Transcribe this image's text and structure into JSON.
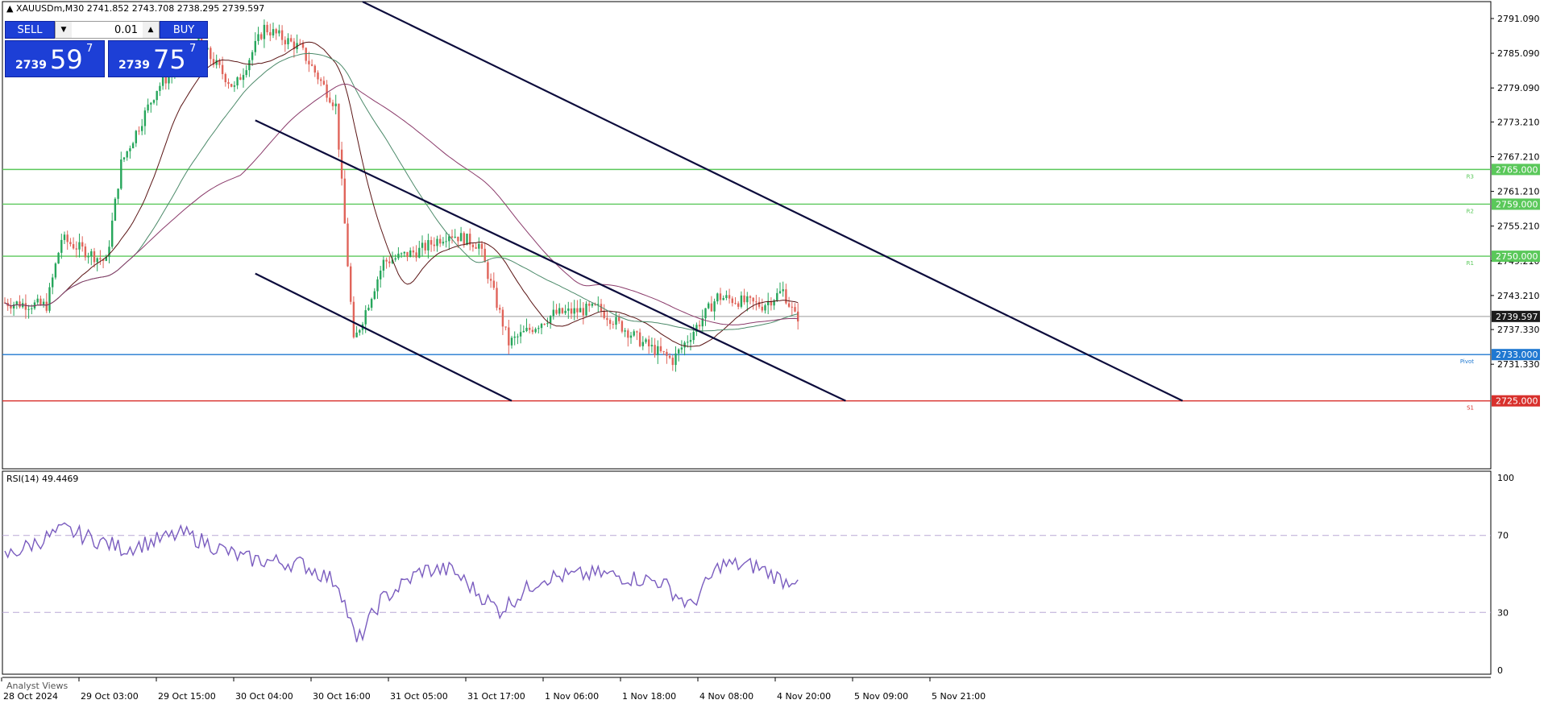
{
  "header": {
    "symbol": "XAUUSDm,M30",
    "ohlc": "2741.852 2743.708 2738.295 2739.597"
  },
  "trade_panel": {
    "sell_label": "SELL",
    "buy_label": "BUY",
    "lot": "0.01",
    "sell_price_small": "2739",
    "sell_price_big": "59",
    "sell_price_sup": "7",
    "buy_price_small": "2739",
    "buy_price_big": "75",
    "buy_price_sup": "7"
  },
  "analyst_views": "Analyst Views",
  "colors": {
    "bull": "#26a65b",
    "bear": "#e0645a",
    "level_green": "#5ac85a",
    "pivot": "#1f78d1",
    "s_level": "#d8302c",
    "trendline": "#0c0c3c",
    "rsi": "#7a5cbf",
    "ma_fast": "#5a1414",
    "ma_mid": "#4c8a6a",
    "ma_slow": "#8a3a6a"
  },
  "chart_data": [
    {
      "type": "candlestick",
      "title": "XAUUSDm,M30",
      "y_range": [
        2725.0,
        2794.0
      ],
      "y_ticks": [
        "2791.090",
        "2785.090",
        "2779.090",
        "2773.210",
        "2767.210",
        "2761.210",
        "2755.210",
        "2749.210",
        "2743.210",
        "2737.330",
        "2731.330"
      ],
      "y_tick_values": [
        2791.09,
        2785.09,
        2779.09,
        2773.21,
        2767.21,
        2761.21,
        2755.21,
        2749.21,
        2743.21,
        2737.33,
        2731.33
      ],
      "x_tick_labels": [
        "28 Oct 2024",
        "29 Oct 03:00",
        "29 Oct 15:00",
        "30 Oct 04:00",
        "30 Oct 16:00",
        "31 Oct 05:00",
        "31 Oct 17:00",
        "1 Nov 06:00",
        "1 Nov 18:00",
        "4 Nov 08:00",
        "4 Nov 20:00",
        "5 Nov 09:00",
        "5 Nov 21:00"
      ],
      "price_path_keypoints": [
        {
          "bar": 0,
          "price": 2742.0
        },
        {
          "bar": 15,
          "price": 2741.5
        },
        {
          "bar": 20,
          "price": 2753.0
        },
        {
          "bar": 35,
          "price": 2749.0
        },
        {
          "bar": 40,
          "price": 2766.0
        },
        {
          "bar": 52,
          "price": 2779.0
        },
        {
          "bar": 66,
          "price": 2787.0
        },
        {
          "bar": 78,
          "price": 2779.0
        },
        {
          "bar": 88,
          "price": 2789.5
        },
        {
          "bar": 100,
          "price": 2786.0
        },
        {
          "bar": 112,
          "price": 2776.0
        },
        {
          "bar": 118,
          "price": 2735.0
        },
        {
          "bar": 128,
          "price": 2749.0
        },
        {
          "bar": 140,
          "price": 2751.0
        },
        {
          "bar": 150,
          "price": 2754.0
        },
        {
          "bar": 160,
          "price": 2752.0
        },
        {
          "bar": 170,
          "price": 2735.0
        },
        {
          "bar": 185,
          "price": 2740.0
        },
        {
          "bar": 200,
          "price": 2741.0
        },
        {
          "bar": 215,
          "price": 2735.0
        },
        {
          "bar": 225,
          "price": 2732.0
        },
        {
          "bar": 240,
          "price": 2743.0
        },
        {
          "bar": 255,
          "price": 2741.5
        },
        {
          "bar": 262,
          "price": 2744.0
        },
        {
          "bar": 266,
          "price": 2739.6
        }
      ],
      "levels": [
        {
          "name": "R3",
          "value": 2765.0,
          "label": "2765.000",
          "color": "#5ac85a"
        },
        {
          "name": "R2",
          "value": 2759.0,
          "label": "2759.000",
          "color": "#5ac85a"
        },
        {
          "name": "R1",
          "value": 2750.0,
          "label": "2750.000",
          "color": "#5ac85a"
        },
        {
          "name": "Pivot",
          "value": 2733.0,
          "label": "2733.000",
          "color": "#1f78d1"
        },
        {
          "name": "S1",
          "value": 2725.0,
          "label": "2725.000",
          "color": "#d8302c"
        }
      ],
      "current_price": {
        "value": 2739.597,
        "label": "2739.597"
      },
      "trendlines": [
        {
          "from": {
            "date": "30 Oct 2024 ~18:00",
            "price": 2794.0
          },
          "to": {
            "date": "6 Nov 2024 ~14:00",
            "price": 2725.0
          }
        },
        {
          "from": {
            "date": "30 Oct 2024 ~12:00",
            "price": 2773.5
          },
          "to": {
            "date": "5 Nov 2024 ~12:00",
            "price": 2725.0
          }
        },
        {
          "from": {
            "date": "30 Oct 2024 ~12:00",
            "price": 2747.0
          },
          "to": {
            "date": "1 Nov 2024 ~06:00",
            "price": 2725.0
          }
        }
      ]
    },
    {
      "type": "line",
      "title": "RSI(14) 49.4469",
      "indicator": "RSI(14)",
      "last_value": 49.4469,
      "y_range": [
        0,
        100
      ],
      "y_ticks": [
        "100",
        "70",
        "30",
        "0"
      ],
      "y_tick_values": [
        100,
        70,
        30,
        0
      ],
      "reference_lines": [
        70,
        30
      ],
      "series_keypoints": [
        {
          "bar": 0,
          "value": 59
        },
        {
          "bar": 20,
          "value": 73
        },
        {
          "bar": 40,
          "value": 63
        },
        {
          "bar": 60,
          "value": 71
        },
        {
          "bar": 80,
          "value": 58
        },
        {
          "bar": 100,
          "value": 55
        },
        {
          "bar": 112,
          "value": 45
        },
        {
          "bar": 118,
          "value": 14
        },
        {
          "bar": 126,
          "value": 36
        },
        {
          "bar": 140,
          "value": 52
        },
        {
          "bar": 150,
          "value": 52
        },
        {
          "bar": 158,
          "value": 41
        },
        {
          "bar": 166,
          "value": 31
        },
        {
          "bar": 180,
          "value": 48
        },
        {
          "bar": 200,
          "value": 50
        },
        {
          "bar": 220,
          "value": 46
        },
        {
          "bar": 230,
          "value": 33
        },
        {
          "bar": 240,
          "value": 55
        },
        {
          "bar": 252,
          "value": 54
        },
        {
          "bar": 262,
          "value": 46
        },
        {
          "bar": 266,
          "value": 49
        }
      ]
    }
  ]
}
